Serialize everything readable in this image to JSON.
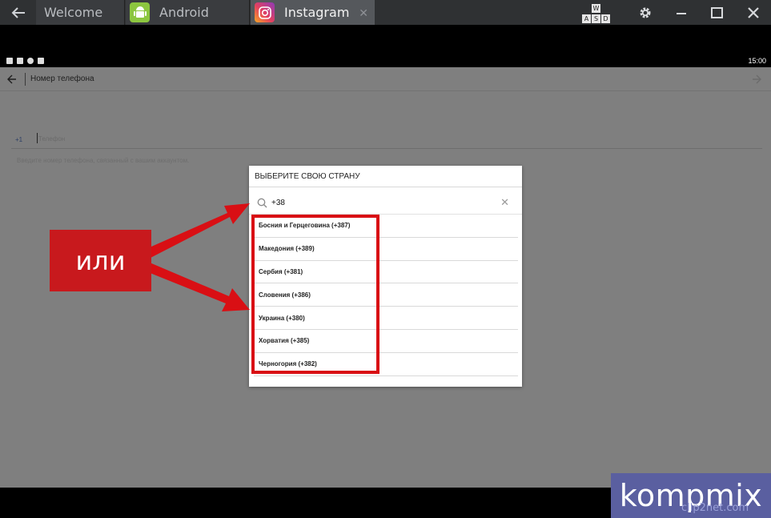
{
  "tabbar": {
    "tabs": [
      {
        "label": "Welcome"
      },
      {
        "label": "Android"
      },
      {
        "label": "Instagram"
      }
    ],
    "keymap_keys": [
      "W",
      "A",
      "S",
      "D"
    ]
  },
  "statusbar": {
    "time": "15:00"
  },
  "app": {
    "title": "Номер телефона",
    "country_code": "+1",
    "phone_placeholder": "Телефон",
    "hint": "Введите номер телефона, связанный с вашим аккаунтом."
  },
  "dialog": {
    "title": "ВЫБЕРИТЕ СВОЮ СТРАНУ",
    "search_value": "+38",
    "countries": [
      "Босния и Герцеговина (+387)",
      "Македония (+389)",
      "Сербия (+381)",
      "Словения (+386)",
      "Украина (+380)",
      "Хорватия (+385)",
      "Черногория (+382)"
    ]
  },
  "annotation": {
    "label": "или",
    "color": "#d90f14"
  },
  "watermark": {
    "brand": "kompmix",
    "sub": "clip2net.com"
  },
  "colors": {
    "accent_red": "#d90f14",
    "overlay": "#7f7f7f",
    "watermark_bg": "#5a5fa0"
  }
}
